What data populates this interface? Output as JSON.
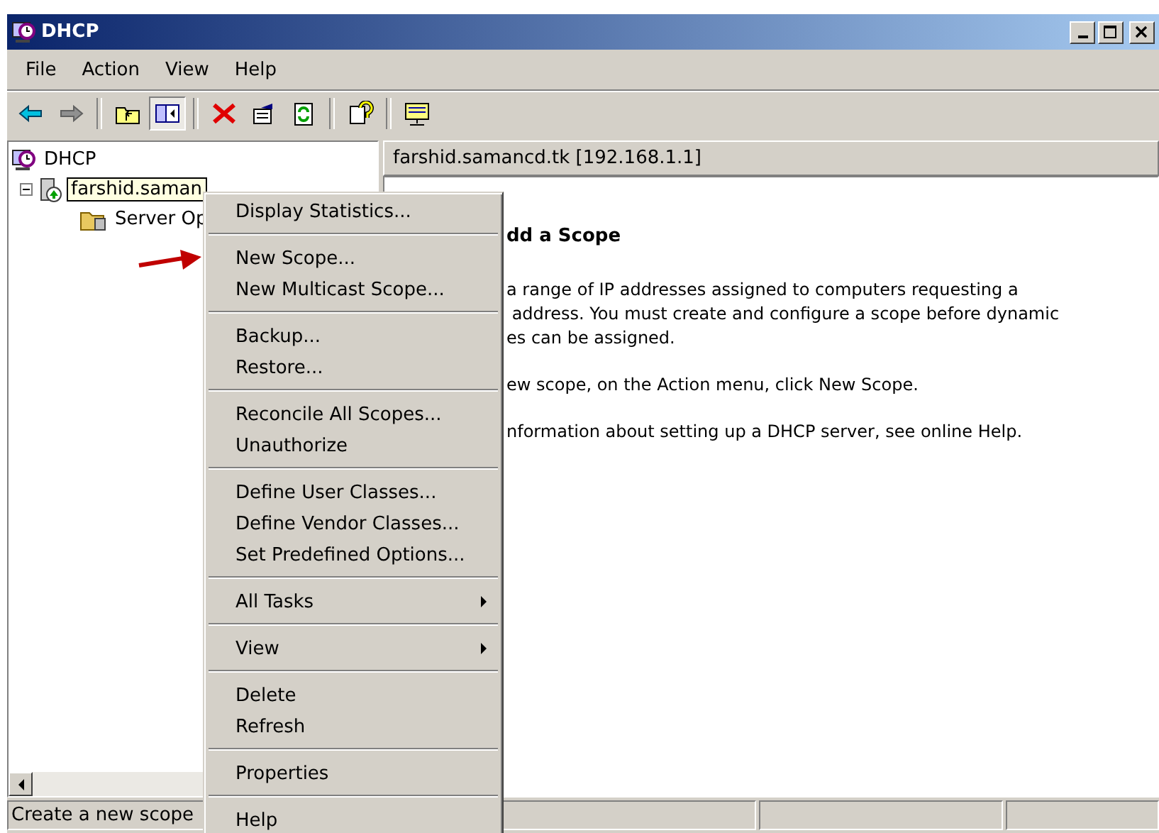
{
  "window": {
    "title": "DHCP"
  },
  "menu_bar": [
    "File",
    "Action",
    "View",
    "Help"
  ],
  "toolbar": [
    {
      "kind": "back",
      "pressed": false
    },
    {
      "kind": "forward",
      "pressed": false
    },
    {
      "kind": "sep"
    },
    {
      "kind": "up",
      "pressed": false
    },
    {
      "kind": "tree",
      "pressed": true
    },
    {
      "kind": "sep"
    },
    {
      "kind": "delete",
      "pressed": false
    },
    {
      "kind": "properties",
      "pressed": false
    },
    {
      "kind": "refresh",
      "pressed": false
    },
    {
      "kind": "sep"
    },
    {
      "kind": "help",
      "pressed": false
    },
    {
      "kind": "sep"
    },
    {
      "kind": "console",
      "pressed": false
    }
  ],
  "tree": {
    "label": "DHCP",
    "children": [
      {
        "label": "farshid.saman",
        "tooltip": true,
        "expanded": true,
        "children": [
          {
            "label": "Server Op",
            "tooltip": false
          }
        ]
      }
    ]
  },
  "details": {
    "header": "farshid.samancd.tk [192.168.1.1]",
    "heading": "dd a Scope",
    "paragraphs": [
      [
        "a range of IP addresses assigned to computers requesting a",
        " address. You must create and configure a scope before dynamic",
        "es can be assigned."
      ],
      [
        "ew scope, on the Action menu, click New Scope."
      ],
      [
        "nformation about setting up a DHCP server, see online Help."
      ]
    ]
  },
  "context_menu": [
    [
      {
        "label": "Display Statistics...",
        "submenu": false
      }
    ],
    [
      {
        "label": "New Scope...",
        "submenu": false
      },
      {
        "label": "New Multicast Scope...",
        "submenu": false
      }
    ],
    [
      {
        "label": "Backup...",
        "submenu": false
      },
      {
        "label": "Restore...",
        "submenu": false
      }
    ],
    [
      {
        "label": "Reconcile All Scopes...",
        "submenu": false
      },
      {
        "label": "Unauthorize",
        "submenu": false
      }
    ],
    [
      {
        "label": "Define User Classes...",
        "submenu": false
      },
      {
        "label": "Define Vendor Classes...",
        "submenu": false
      },
      {
        "label": "Set Predefined Options...",
        "submenu": false
      }
    ],
    [
      {
        "label": "All Tasks",
        "submenu": true
      }
    ],
    [
      {
        "label": "View",
        "submenu": true
      }
    ],
    [
      {
        "label": "Delete",
        "submenu": false
      },
      {
        "label": "Refresh",
        "submenu": false
      }
    ],
    [
      {
        "label": "Properties",
        "submenu": false
      }
    ],
    [
      {
        "label": "Help",
        "submenu": false
      }
    ]
  ],
  "status_bar": [
    "Create a new scope"
  ]
}
